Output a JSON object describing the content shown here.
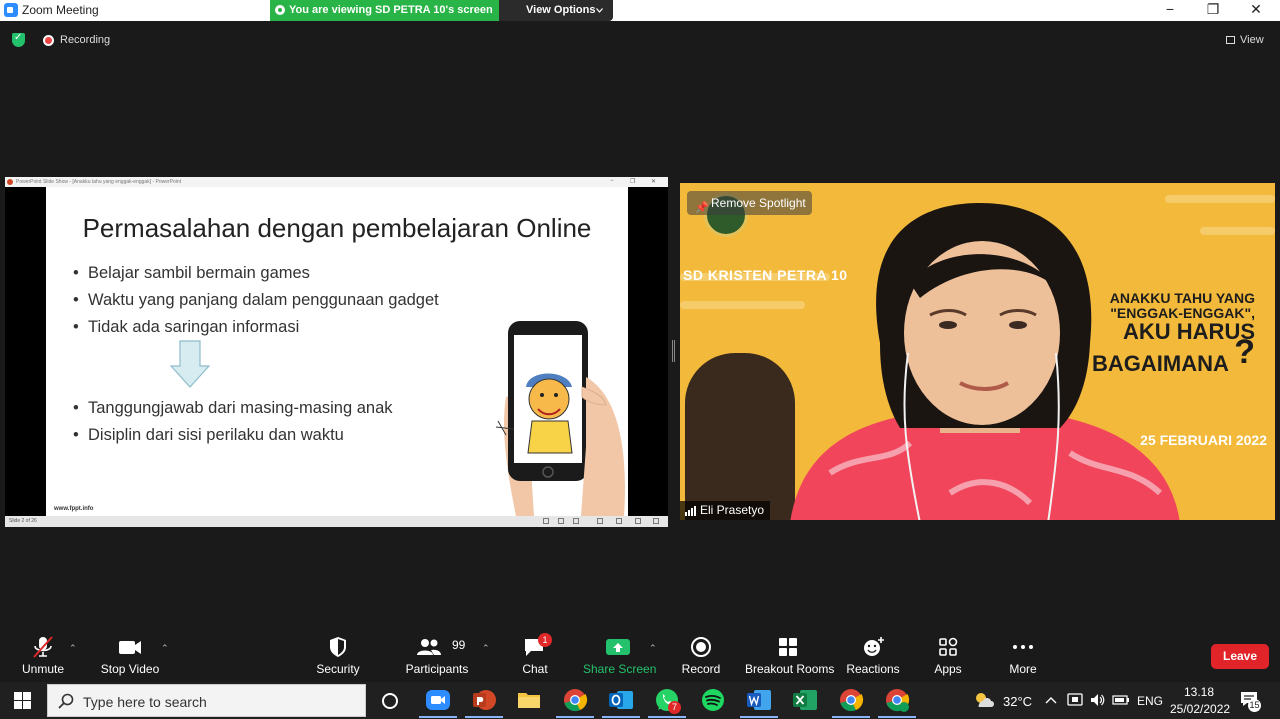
{
  "window": {
    "title": "Zoom Meeting",
    "viewing_banner": "You are viewing SD PETRA 10's screen",
    "view_options": "View Options",
    "minimize": "−",
    "restore": "❐",
    "close": "✕"
  },
  "topbar": {
    "recording_label": "Recording",
    "view_label": "View"
  },
  "share": {
    "window_title": "PowerPoint Slide Show - [Anakku tahu yang enggak-enggak] - PowerPoint",
    "slide": {
      "title": "Permasalahan dengan pembelajaran Online",
      "bullets_top": [
        "Belajar sambil bermain games",
        "Waktu yang panjang dalam penggunaan gadget",
        "Tidak ada saringan informasi"
      ],
      "bullets_bottom": [
        "Tanggungjawab dari masing-masing anak",
        "Disiplin dari sisi perilaku dan waktu"
      ],
      "footer": "www.fppt.info"
    },
    "status": "Slide 2 of 26"
  },
  "video": {
    "spotlight_label": "Remove Spotlight",
    "school_name": "SD KRISTEN PETRA 10",
    "poster_lines": [
      "ANAKKU TAHU YANG",
      "\"ENGGAK-ENGGAK\",",
      "AKU HARUS",
      "BAGAIMANA"
    ],
    "question_mark": "?",
    "poster_date": "25 FEBRUARI 2022",
    "participant_name": "Eli Prasetyo"
  },
  "toolbar": {
    "unmute": "Unmute",
    "stop_video": "Stop Video",
    "security": "Security",
    "participants": "Participants",
    "participants_count": "99",
    "chat": "Chat",
    "chat_badge": "1",
    "share_screen": "Share Screen",
    "record": "Record",
    "breakout_rooms": "Breakout Rooms",
    "reactions": "Reactions",
    "apps": "Apps",
    "more": "More",
    "leave": "Leave"
  },
  "taskbar": {
    "search_placeholder": "Type here to search",
    "whatsapp_badge": "7",
    "temperature": "32°C",
    "language": "ENG",
    "time": "13.18",
    "date": "25/02/2022",
    "notification_count": "15"
  },
  "colors": {
    "accent_green": "#28b446",
    "zoom_blue": "#2d8cff",
    "leave_red": "#e0242a",
    "poster_yellow": "#f3b93b"
  }
}
